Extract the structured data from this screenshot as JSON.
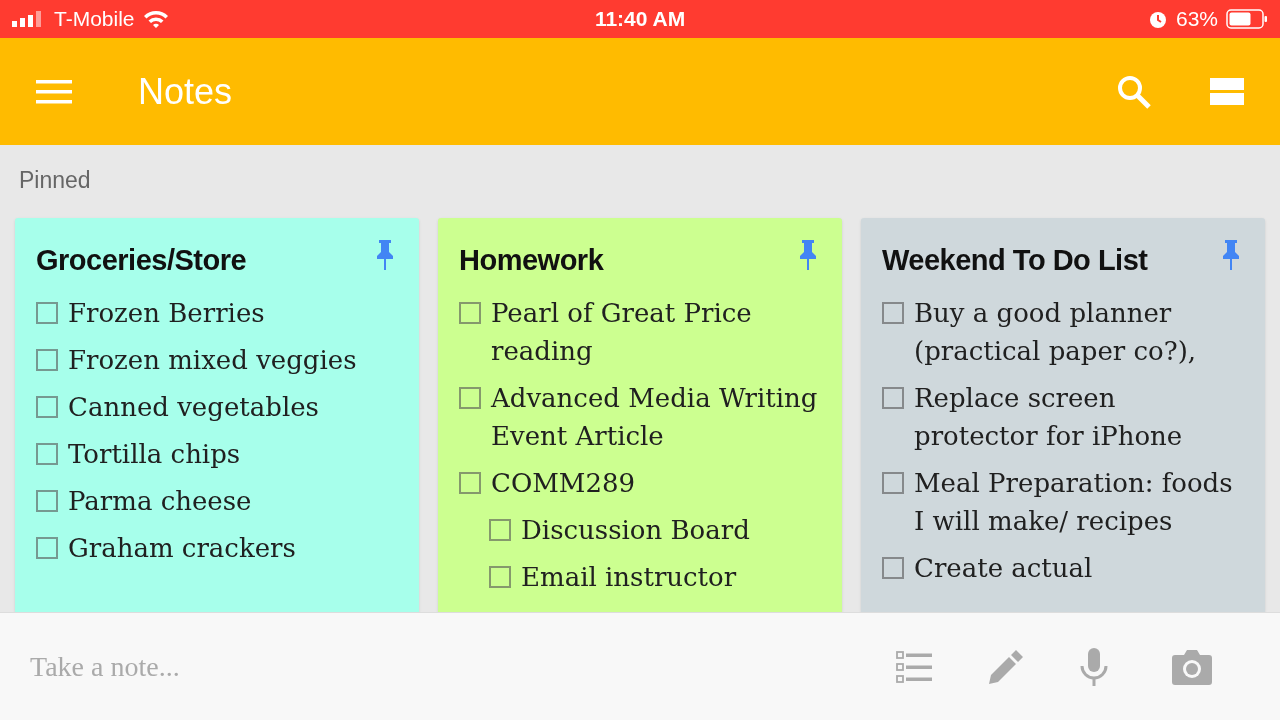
{
  "status_bar": {
    "carrier": "T-Mobile",
    "time": "11:40 AM",
    "battery": "63%"
  },
  "app_bar": {
    "title": "Notes"
  },
  "section_label": "Pinned",
  "notes": [
    {
      "title": "Groceries/Store",
      "color": "#a7ffeb",
      "pinned": true,
      "items": [
        {
          "text": "Frozen Berries",
          "checked": false
        },
        {
          "text": "Frozen mixed veggies",
          "checked": false
        },
        {
          "text": "Canned vegetables",
          "checked": false
        },
        {
          "text": "Tortilla chips",
          "checked": false
        },
        {
          "text": "Parma cheese",
          "checked": false
        },
        {
          "text": "Graham crackers",
          "checked": false
        }
      ]
    },
    {
      "title": "Homework",
      "color": "#ccff90",
      "pinned": true,
      "items": [
        {
          "text": "Pearl of Great Price reading",
          "checked": false
        },
        {
          "text": "Advanced Media Writing Event Article",
          "checked": false
        },
        {
          "text": "COMM289",
          "checked": false,
          "children": [
            {
              "text": "Discussion Board",
              "checked": false
            },
            {
              "text": "Email instructor",
              "checked": false
            }
          ]
        }
      ]
    },
    {
      "title": "Weekend To Do List",
      "color": "#cfd8dc",
      "pinned": true,
      "items": [
        {
          "text": "Buy a good planner (practical paper co?),",
          "checked": false
        },
        {
          "text": "Replace screen protector for iPhone",
          "checked": false
        },
        {
          "text": "Meal Preparation: foods I will make/ recipes",
          "checked": false
        },
        {
          "text": "Create actual",
          "checked": false
        }
      ]
    }
  ],
  "bottom_bar": {
    "placeholder": "Take a note..."
  }
}
